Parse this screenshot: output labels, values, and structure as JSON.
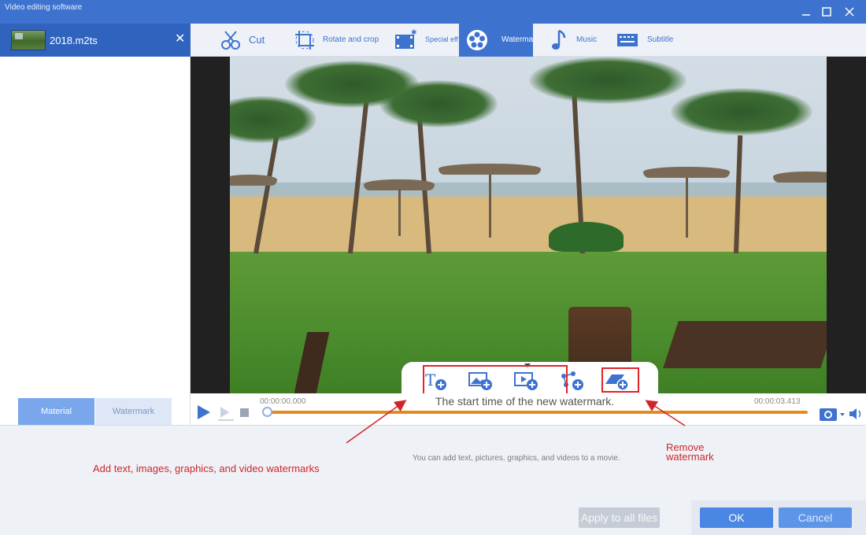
{
  "app": {
    "title": "Video editing software"
  },
  "file_tab": {
    "name": "2018.m2ts"
  },
  "toolbar": {
    "items": [
      {
        "label": "Cut",
        "icon": "cut-icon"
      },
      {
        "label": "Rotate and crop",
        "icon": "crop-icon"
      },
      {
        "label": "Special effects",
        "icon": "effects-icon"
      },
      {
        "label": "Watermark",
        "icon": "watermark-icon",
        "active": true
      },
      {
        "label": "Music",
        "icon": "music-icon"
      },
      {
        "label": "Subtitle",
        "icon": "subtitle-icon"
      }
    ]
  },
  "left_tabs": {
    "material": "Material",
    "watermark": "Watermark"
  },
  "player": {
    "time_start": "00:00:00.000",
    "time_end": "00:00:03.413",
    "hint": "The start time of the new watermark."
  },
  "watermark_tools": [
    {
      "icon": "add-text-watermark-icon"
    },
    {
      "icon": "add-image-watermark-icon"
    },
    {
      "icon": "add-video-watermark-icon"
    },
    {
      "icon": "add-graphic-watermark-icon"
    },
    {
      "icon": "remove-watermark-icon"
    }
  ],
  "panel": {
    "description": "You can add text, pictures, graphics, and videos to a movie."
  },
  "annotations": {
    "add_text": "Add text, images, graphics, and video watermarks",
    "remove": "Remove watermark"
  },
  "buttons": {
    "apply_all": "Apply to all files",
    "ok": "OK",
    "cancel": "Cancel"
  },
  "colors": {
    "accent": "#3d73cf",
    "annotation": "#d0262b",
    "progress": "#e58a1c"
  }
}
